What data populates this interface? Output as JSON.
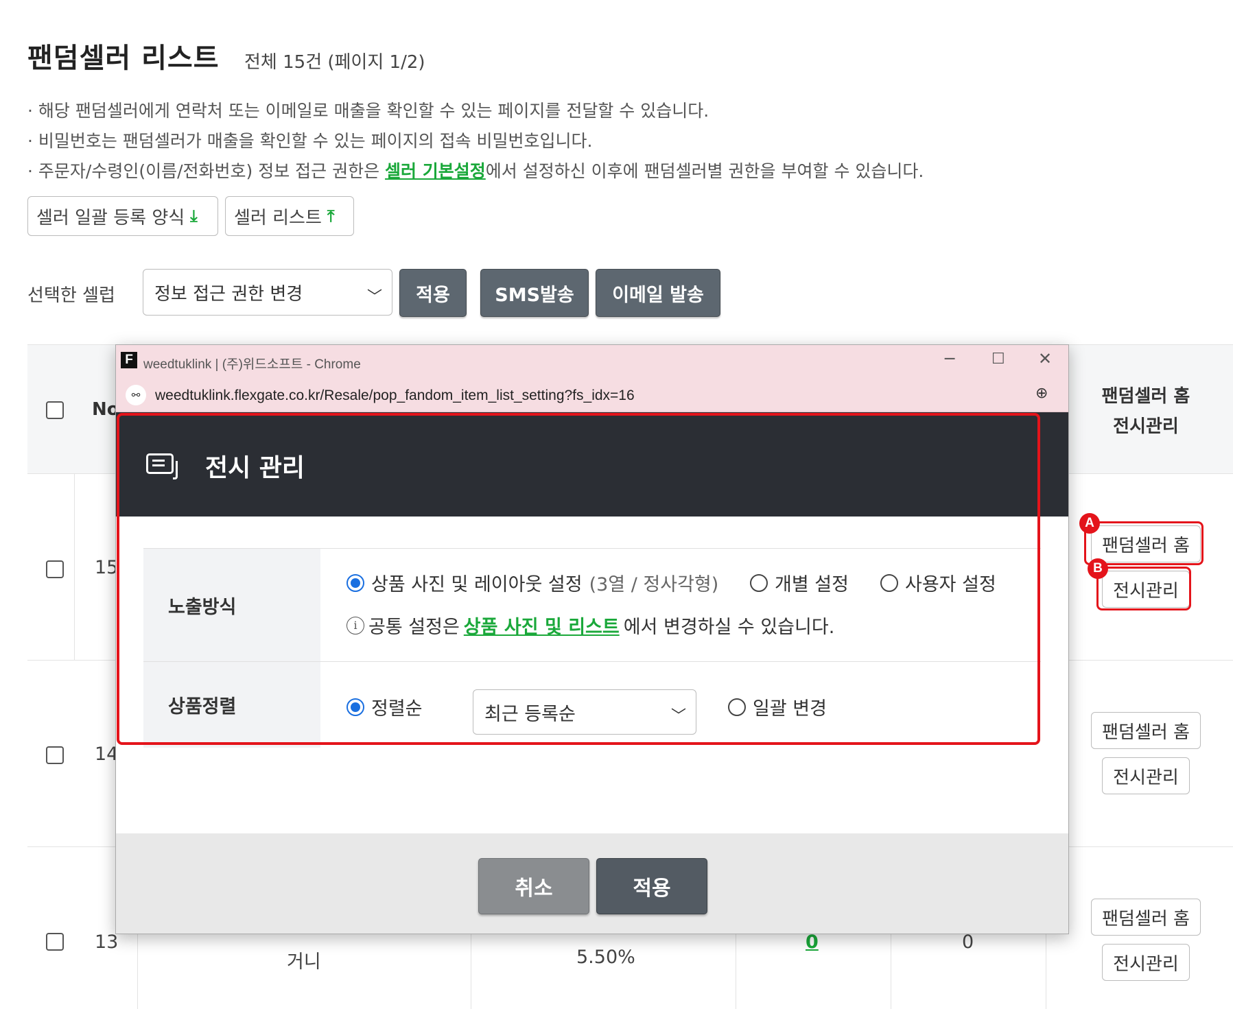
{
  "header": {
    "title": "팬덤셀러 리스트",
    "count": "전체 15건 (페이지 1/2)"
  },
  "notes": {
    "line1": "· 해당 팬덤셀러에게 연락처 또는 이메일로 매출을 확인할 수 있는 페이지를 전달할 수 있습니다.",
    "line2": "· 비밀번호는 팬덤셀러가 매출을 확인할 수 있는 페이지의 접속 비밀번호입니다.",
    "line3_prefix": "· 주문자/수령인(이름/전화번호) 정보 접근 권한은 ",
    "line3_link": "셀러 기본설정",
    "line3_suffix": "에서 설정하신 이후에 팬덤셀러별 권한을 부여할 수 있습니다."
  },
  "toolbar": {
    "bulk_form_label": "셀러 일괄 등록 양식",
    "seller_list_label": "셀러 리스트"
  },
  "actions": {
    "selected_label": "선택한 셀럽",
    "select_value": "정보 접근 권한 변경",
    "apply_label": "적용",
    "sms_label": "SMS발송",
    "email_label": "이메일 발송"
  },
  "table": {
    "header_no": "No",
    "header_right_line1": "팬덤셀러 홈",
    "header_right_line2": "전시관리",
    "rows": [
      {
        "no": "15",
        "home_label": "팬덤셀러 홈",
        "display_label": "전시관리"
      },
      {
        "no": "14",
        "home_label": "팬덤셀러 홈",
        "display_label": "전시관리"
      },
      {
        "no": "13",
        "name": "거니",
        "rate": "5.50%",
        "count_link": "0",
        "count2": "0",
        "home_label": "팬덤셀러 홈",
        "display_label": "전시관리"
      }
    ]
  },
  "annotations": {
    "badge_a": "A",
    "badge_b": "B"
  },
  "popup": {
    "window_title": "weedtuklink | (주)위드소프트 - Chrome",
    "url": "weedtuklink.flexgate.co.kr/Resale/pop_fandom_item_list_setting?fs_idx=16",
    "modal_title": "전시 관리",
    "exposure": {
      "label": "노출방식",
      "option1": "상품 사진 및 레이아웃 설정",
      "option1_detail": "(3열 / 정사각형)",
      "option2": "개별 설정",
      "option3": "사용자 설정",
      "info_prefix": "공통 설정은 ",
      "info_link": "상품 사진 및 리스트",
      "info_suffix": "에서 변경하실 수 있습니다."
    },
    "sort": {
      "label": "상품정렬",
      "option1": "정렬순",
      "select_value": "최근 등록순",
      "option2": "일괄 변경"
    },
    "cancel_label": "취소",
    "apply_label": "적용"
  },
  "colors": {
    "accent_green": "#1aa83a",
    "highlight_red": "#e4141b",
    "modal_header": "#2b2e34",
    "radio_blue": "#1a6fe0"
  }
}
